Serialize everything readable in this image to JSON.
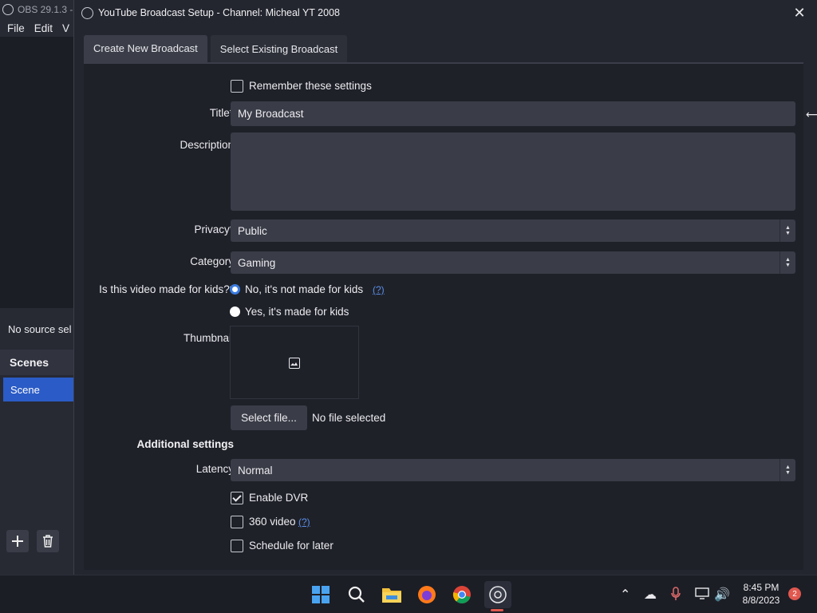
{
  "obs": {
    "title": "OBS 29.1.3 -",
    "menu": [
      "File",
      "Edit",
      "V"
    ],
    "no_source": "No source sel",
    "scenes_header": "Scenes",
    "scene_item": "Scene"
  },
  "dialog": {
    "title": "YouTube Broadcast Setup - Channel: Micheal YT 2008",
    "close": "✕",
    "tabs": [
      "Create New Broadcast",
      "Select Existing Broadcast"
    ],
    "active_tab": 0
  },
  "form": {
    "remember": {
      "label": "Remember these settings",
      "checked": false
    },
    "title": {
      "label": "Title*",
      "value": "My Broadcast"
    },
    "description": {
      "label": "Description",
      "value": ""
    },
    "privacy": {
      "label": "Privacy*",
      "value": "Public"
    },
    "category": {
      "label": "Category",
      "value": "Gaming"
    },
    "kids": {
      "label": "Is this video made for kids?*",
      "options": [
        "No, it's not made for kids",
        "Yes, it's made for kids"
      ],
      "selected": 0,
      "help": "(?)"
    },
    "thumbnail": {
      "label": "Thumbnail",
      "select_button": "Select file...",
      "status": "No file selected"
    },
    "additional": {
      "heading": "Additional settings"
    },
    "latency": {
      "label": "Latency",
      "value": "Normal"
    },
    "enable_dvr": {
      "label": "Enable DVR",
      "checked": true
    },
    "video360": {
      "label": "360 video",
      "checked": false,
      "help": "(?)"
    },
    "schedule": {
      "label": "Schedule for later",
      "checked": false
    }
  },
  "taskbar": {
    "time": "8:45 PM",
    "date": "8/8/2023",
    "notifications": "2"
  },
  "colors": {
    "accent": "#3b7bdf",
    "link": "#5a8fe8",
    "scene_selected": "#2b5bc6",
    "notification": "#e0584f"
  }
}
